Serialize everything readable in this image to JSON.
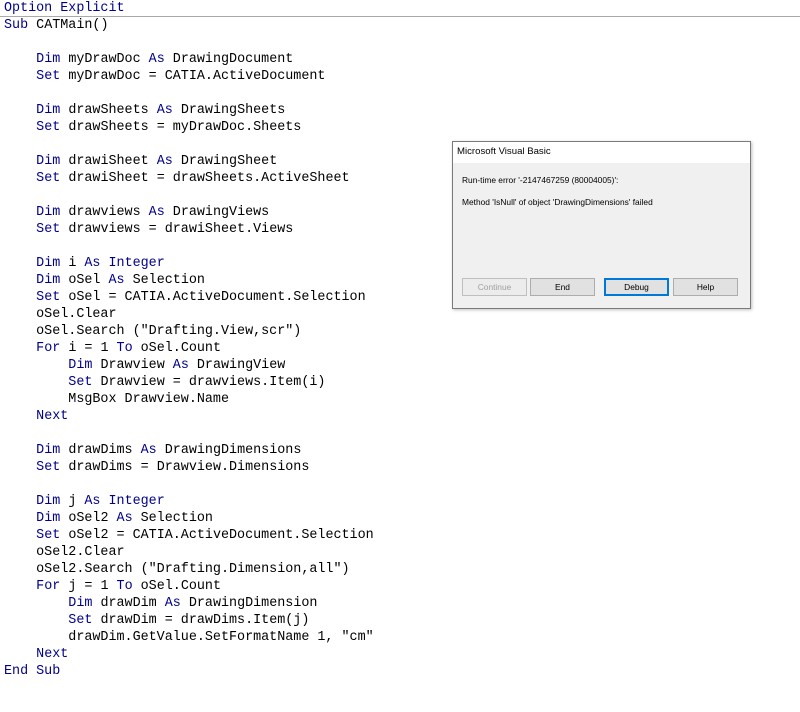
{
  "code_lines": [
    [
      {
        "t": "Option Explicit",
        "k": true
      }
    ],
    [
      {
        "t": "Sub ",
        "k": true
      },
      {
        "t": "CATMain()",
        "k": false
      }
    ],
    [],
    [
      {
        "t": "    ",
        "k": false
      },
      {
        "t": "Dim ",
        "k": true
      },
      {
        "t": "myDrawDoc ",
        "k": false
      },
      {
        "t": "As ",
        "k": true
      },
      {
        "t": "DrawingDocument",
        "k": false
      }
    ],
    [
      {
        "t": "    ",
        "k": false
      },
      {
        "t": "Set ",
        "k": true
      },
      {
        "t": "myDrawDoc = CATIA.ActiveDocument",
        "k": false
      }
    ],
    [],
    [
      {
        "t": "    ",
        "k": false
      },
      {
        "t": "Dim ",
        "k": true
      },
      {
        "t": "drawSheets ",
        "k": false
      },
      {
        "t": "As ",
        "k": true
      },
      {
        "t": "DrawingSheets",
        "k": false
      }
    ],
    [
      {
        "t": "    ",
        "k": false
      },
      {
        "t": "Set ",
        "k": true
      },
      {
        "t": "drawSheets = myDrawDoc.Sheets",
        "k": false
      }
    ],
    [],
    [
      {
        "t": "    ",
        "k": false
      },
      {
        "t": "Dim ",
        "k": true
      },
      {
        "t": "drawiSheet ",
        "k": false
      },
      {
        "t": "As ",
        "k": true
      },
      {
        "t": "DrawingSheet",
        "k": false
      }
    ],
    [
      {
        "t": "    ",
        "k": false
      },
      {
        "t": "Set ",
        "k": true
      },
      {
        "t": "drawiSheet = drawSheets.ActiveSheet",
        "k": false
      }
    ],
    [],
    [
      {
        "t": "    ",
        "k": false
      },
      {
        "t": "Dim ",
        "k": true
      },
      {
        "t": "drawviews ",
        "k": false
      },
      {
        "t": "As ",
        "k": true
      },
      {
        "t": "DrawingViews",
        "k": false
      }
    ],
    [
      {
        "t": "    ",
        "k": false
      },
      {
        "t": "Set ",
        "k": true
      },
      {
        "t": "drawviews = drawiSheet.Views",
        "k": false
      }
    ],
    [],
    [
      {
        "t": "    ",
        "k": false
      },
      {
        "t": "Dim ",
        "k": true
      },
      {
        "t": "i ",
        "k": false
      },
      {
        "t": "As Integer",
        "k": true
      }
    ],
    [
      {
        "t": "    ",
        "k": false
      },
      {
        "t": "Dim ",
        "k": true
      },
      {
        "t": "oSel ",
        "k": false
      },
      {
        "t": "As ",
        "k": true
      },
      {
        "t": "Selection",
        "k": false
      }
    ],
    [
      {
        "t": "    ",
        "k": false
      },
      {
        "t": "Set ",
        "k": true
      },
      {
        "t": "oSel = CATIA.ActiveDocument.Selection",
        "k": false
      }
    ],
    [
      {
        "t": "    oSel.Clear",
        "k": false
      }
    ],
    [
      {
        "t": "    oSel.Search (\"Drafting.View,scr\")",
        "k": false
      }
    ],
    [
      {
        "t": "    ",
        "k": false
      },
      {
        "t": "For ",
        "k": true
      },
      {
        "t": "i = 1 ",
        "k": false
      },
      {
        "t": "To ",
        "k": true
      },
      {
        "t": "oSel.Count",
        "k": false
      }
    ],
    [
      {
        "t": "        ",
        "k": false
      },
      {
        "t": "Dim ",
        "k": true
      },
      {
        "t": "Drawview ",
        "k": false
      },
      {
        "t": "As ",
        "k": true
      },
      {
        "t": "DrawingView",
        "k": false
      }
    ],
    [
      {
        "t": "        ",
        "k": false
      },
      {
        "t": "Set ",
        "k": true
      },
      {
        "t": "Drawview = drawviews.Item(i)",
        "k": false
      }
    ],
    [
      {
        "t": "        MsgBox Drawview.Name",
        "k": false
      }
    ],
    [
      {
        "t": "    ",
        "k": false
      },
      {
        "t": "Next",
        "k": true
      }
    ],
    [],
    [
      {
        "t": "    ",
        "k": false
      },
      {
        "t": "Dim ",
        "k": true
      },
      {
        "t": "drawDims ",
        "k": false
      },
      {
        "t": "As ",
        "k": true
      },
      {
        "t": "DrawingDimensions",
        "k": false
      }
    ],
    [
      {
        "t": "    ",
        "k": false
      },
      {
        "t": "Set ",
        "k": true
      },
      {
        "t": "drawDims = Drawview.Dimensions",
        "k": false
      }
    ],
    [],
    [
      {
        "t": "    ",
        "k": false
      },
      {
        "t": "Dim ",
        "k": true
      },
      {
        "t": "j ",
        "k": false
      },
      {
        "t": "As Integer",
        "k": true
      }
    ],
    [
      {
        "t": "    ",
        "k": false
      },
      {
        "t": "Dim ",
        "k": true
      },
      {
        "t": "oSel2 ",
        "k": false
      },
      {
        "t": "As ",
        "k": true
      },
      {
        "t": "Selection",
        "k": false
      }
    ],
    [
      {
        "t": "    ",
        "k": false
      },
      {
        "t": "Set ",
        "k": true
      },
      {
        "t": "oSel2 = CATIA.ActiveDocument.Selection",
        "k": false
      }
    ],
    [
      {
        "t": "    oSel2.Clear",
        "k": false
      }
    ],
    [
      {
        "t": "    oSel2.Search (\"Drafting.Dimension,all\")",
        "k": false
      }
    ],
    [
      {
        "t": "    ",
        "k": false
      },
      {
        "t": "For ",
        "k": true
      },
      {
        "t": "j = 1 ",
        "k": false
      },
      {
        "t": "To ",
        "k": true
      },
      {
        "t": "oSel.Count",
        "k": false
      }
    ],
    [
      {
        "t": "        ",
        "k": false
      },
      {
        "t": "Dim ",
        "k": true
      },
      {
        "t": "drawDim ",
        "k": false
      },
      {
        "t": "As ",
        "k": true
      },
      {
        "t": "DrawingDimension",
        "k": false
      }
    ],
    [
      {
        "t": "        ",
        "k": false
      },
      {
        "t": "Set ",
        "k": true
      },
      {
        "t": "drawDim = drawDims.Item(j)",
        "k": false
      }
    ],
    [
      {
        "t": "        drawDim.GetValue.SetFormatName 1, \"cm\"",
        "k": false
      }
    ],
    [
      {
        "t": "    ",
        "k": false
      },
      {
        "t": "Next",
        "k": true
      }
    ],
    [
      {
        "t": "End Sub",
        "k": true
      }
    ]
  ],
  "dialog": {
    "title": "Microsoft Visual Basic",
    "error_line": "Run-time error '-2147467259 (80004005)':",
    "message_line": "Method 'IsNull' of object 'DrawingDimensions' failed",
    "buttons": {
      "continue": "Continue",
      "end": "End",
      "debug": "Debug",
      "help": "Help"
    }
  },
  "colors": {
    "keyword": "#00008b",
    "text": "#000000",
    "dialog_bg": "#f0f0f0"
  }
}
